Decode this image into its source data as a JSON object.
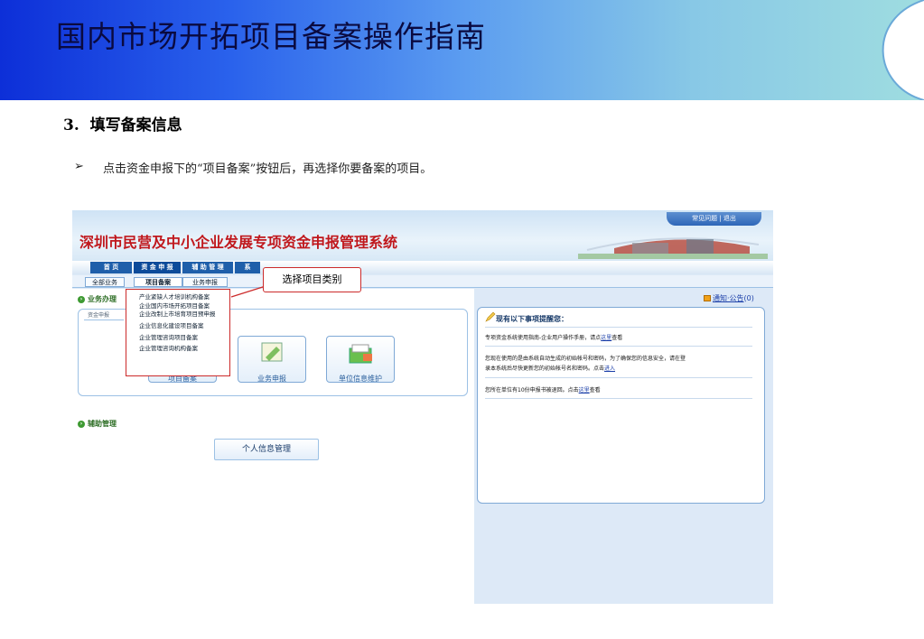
{
  "slide": {
    "title": "国内市场开拓项目备案操作指南",
    "step_heading": "3.  填写备案信息",
    "bullet_marker": "➢",
    "bullet_text": "点击资金申报下的“项目备案”按钮后，再选择你要备案的项目。"
  },
  "app": {
    "title": "深圳市民营及中小企业发展专项资金申报管理系统",
    "top_links": {
      "faq": "常见问题",
      "separator": "|",
      "logout": "退出"
    },
    "main_nav": {
      "home": "首 页",
      "funds": "资 金 申 报",
      "aux": "辅 助 管 理",
      "sys": "系"
    },
    "sub_nav": {
      "all": "全部业务",
      "project_filing": "项目备案",
      "business_report": "业务申报"
    },
    "left": {
      "section_business": "业务办理",
      "panel_tab": "资金申报",
      "dropdown_items": [
        "产业紧缺人才培训机构备案",
        "企业国内市场开拓项目备案",
        "企业改制上市培育项目预申报",
        "企业信息化建设项目备案",
        "企业管理咨询项目备案",
        "企业管理咨询机构备案"
      ],
      "buttons": {
        "project_filing": "项目备案",
        "business_report": "业务申报",
        "unit_info": "单位信息维护"
      },
      "section_aux": "辅助管理",
      "personal_info": "个人信息管理"
    },
    "callout": "选择项目类别",
    "right": {
      "notice_label": "通知·公告",
      "notice_count": "(0)",
      "reminder_title": "现有以下事项提醒您：",
      "reminders": [
        {
          "before": "专项资金系统使用指南-企业用户操作手册，请点",
          "link": "这里",
          "after": "查看"
        },
        {
          "before": "您现在使用的是由系统自动生成的初始帐号和密码，为了确保您的信息安全，请在登",
          "link": "",
          "after": ""
        },
        {
          "before": "录本系统后尽快更新您的初始帐号名和密码。点击",
          "link": "进入",
          "after": ""
        },
        {
          "before": "您所在单位有10份申报书被退回。点击",
          "link": "这里",
          "after": "查看"
        }
      ]
    }
  },
  "colors": {
    "banner_start": "#0d2fd8",
    "banner_end": "#9fdde0",
    "app_title": "#c0181d",
    "highlight_border": "#cc2a2a"
  }
}
